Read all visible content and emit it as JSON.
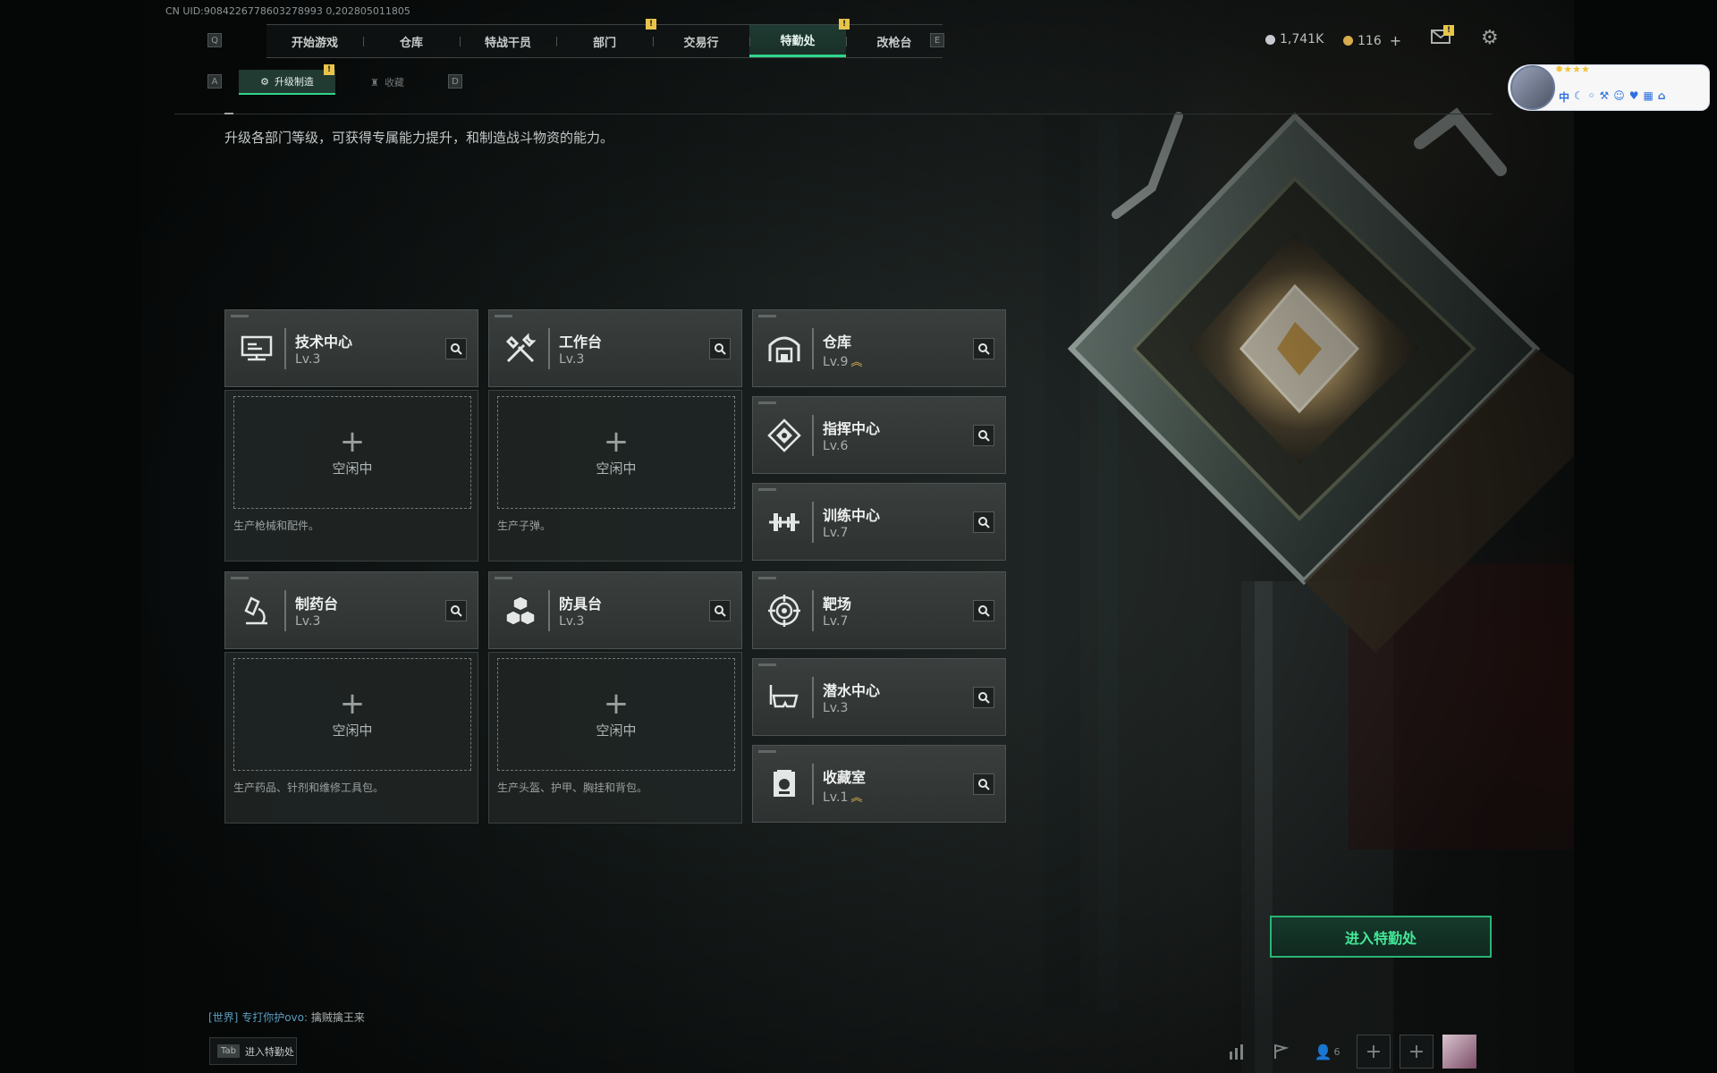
{
  "meta": {
    "uid": "CN UID:9084226778603278993 0,202805011805"
  },
  "nav": {
    "left_key": "Q",
    "right_key": "E",
    "tabs": [
      {
        "label": "开始游戏",
        "badge": ""
      },
      {
        "label": "仓库",
        "badge": ""
      },
      {
        "label": "特战干员",
        "badge": ""
      },
      {
        "label": "部门",
        "badge": "!"
      },
      {
        "label": "交易行",
        "badge": ""
      },
      {
        "label": "特勤处",
        "badge": "!"
      },
      {
        "label": "改枪台",
        "badge": ""
      }
    ],
    "active_index": 5
  },
  "currency": {
    "silver": "1,741K",
    "gold": "116",
    "gold_add": "+"
  },
  "subnav": {
    "left_key": "A",
    "right_key": "D",
    "upgrade_label": "升级制造",
    "upgrade_badge": "!",
    "collect_label": "收藏"
  },
  "description": "升级各部门等级，可获得专属能力提升，和制造战斗物资的能力。",
  "departments": [
    {
      "name": "技术中心",
      "level": "Lv.3",
      "upgrade": false,
      "icon": "monitor-icon"
    },
    {
      "name": "工作台",
      "level": "Lv.3",
      "upgrade": false,
      "icon": "tools-icon"
    },
    {
      "name": "仓库",
      "level": "Lv.9",
      "upgrade": true,
      "icon": "warehouse-icon"
    },
    {
      "name": "指挥中心",
      "level": "Lv.6",
      "upgrade": false,
      "icon": "chip-icon"
    },
    {
      "name": "训练中心",
      "level": "Lv.7",
      "upgrade": false,
      "icon": "dumbbell-icon"
    },
    {
      "name": "制药台",
      "level": "Lv.3",
      "upgrade": false,
      "icon": "microscope-icon"
    },
    {
      "name": "防具台",
      "level": "Lv.3",
      "upgrade": false,
      "icon": "cubes-icon"
    },
    {
      "name": "靶场",
      "level": "Lv.7",
      "upgrade": false,
      "icon": "target-icon"
    },
    {
      "name": "潜水中心",
      "level": "Lv.3",
      "upgrade": false,
      "icon": "diving-mask-icon"
    },
    {
      "name": "收藏室",
      "level": "Lv.1",
      "upgrade": true,
      "icon": "collection-icon"
    }
  ],
  "production": [
    {
      "status": "空闲中",
      "plus": "+",
      "desc": "生产枪械和配件。"
    },
    {
      "status": "空闲中",
      "plus": "+",
      "desc": "生产子弹。"
    },
    {
      "status": "空闲中",
      "plus": "+",
      "desc": "生产药品、针剂和维修工具包。"
    },
    {
      "status": "空闲中",
      "plus": "+",
      "desc": "生产头盔、护甲、胸挂和背包。"
    }
  ],
  "enter_button": "进入特勤处",
  "chat": {
    "channel": "[世界]",
    "user": "专打你护ovo:",
    "message": "擒贼擒王来"
  },
  "tab_hint": {
    "key": "Tab",
    "label": "进入特勤处"
  },
  "bottom": {
    "friends_count": "6"
  },
  "overlay": {
    "lang": "中",
    "stars": "✹★★★"
  },
  "colors": {
    "accent": "#2fd68b",
    "badge": "#e8c44a",
    "upgrade": "#e8b84a"
  }
}
